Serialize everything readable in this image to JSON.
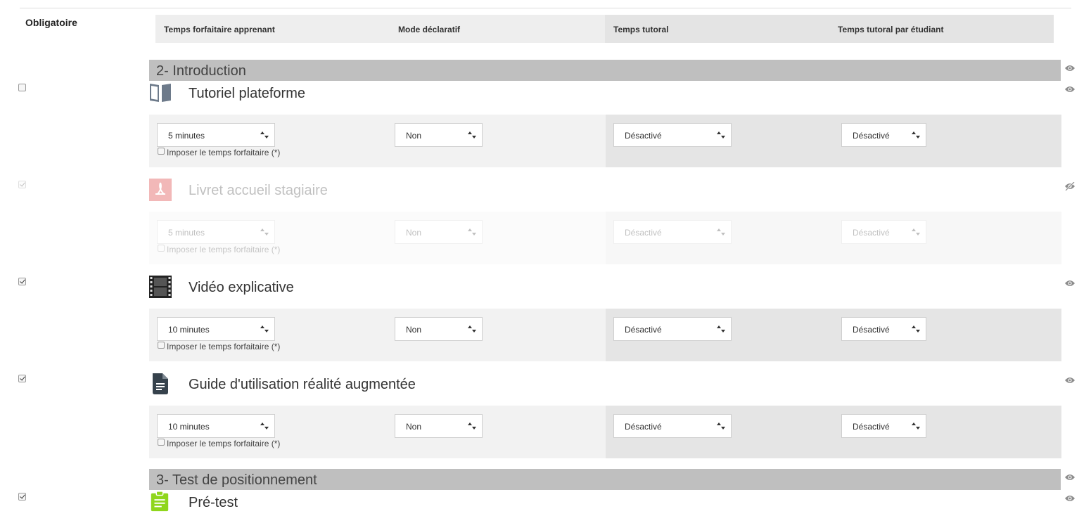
{
  "header": {
    "required_label": "Obligatoire",
    "columns": [
      "Temps forfaitaire apprenant",
      "Mode déclaratif",
      "Temps tutoral",
      "Temps tutoral par étudiant"
    ]
  },
  "sections": [
    {
      "title": "2- Introduction"
    },
    {
      "title": "3- Test de positionnement"
    }
  ],
  "resources": [
    {
      "title": "Tutoriel plateforme",
      "icon": "book-icon",
      "required": false,
      "visible": true,
      "learner_time": "5 minutes",
      "declarative": "Non",
      "tutor_time": "Désactivé",
      "tutor_per_student": "Désactivé",
      "impose_label": "Imposer le temps forfaitaire (*)"
    },
    {
      "title": "Livret accueil stagiaire",
      "icon": "pdf-icon",
      "required": true,
      "visible": false,
      "learner_time": "5 minutes",
      "declarative": "Non",
      "tutor_time": "Désactivé",
      "tutor_per_student": "Désactivé",
      "impose_label": "Imposer le temps forfaitaire (*)"
    },
    {
      "title": "Vidéo explicative",
      "icon": "film-icon",
      "required": true,
      "visible": true,
      "learner_time": "10 minutes",
      "declarative": "Non",
      "tutor_time": "Désactivé",
      "tutor_per_student": "Désactivé",
      "impose_label": "Imposer le temps forfaitaire (*)"
    },
    {
      "title": "Guide d'utilisation réalité augmentée",
      "icon": "document-icon",
      "required": true,
      "visible": true,
      "learner_time": "10 minutes",
      "declarative": "Non",
      "tutor_time": "Désactivé",
      "tutor_per_student": "Désactivé",
      "impose_label": "Imposer le temps forfaitaire (*)"
    },
    {
      "title": "Pré-test",
      "icon": "clipboard-icon",
      "required": true,
      "visible": true
    }
  ],
  "colors": {
    "section_bar": "#bfbfbf",
    "pdf_icon": "#f2b8b8",
    "clipboard_icon": "#8fd61c",
    "book_icon": "#6d7a8a",
    "document_icon": "#36424c"
  }
}
